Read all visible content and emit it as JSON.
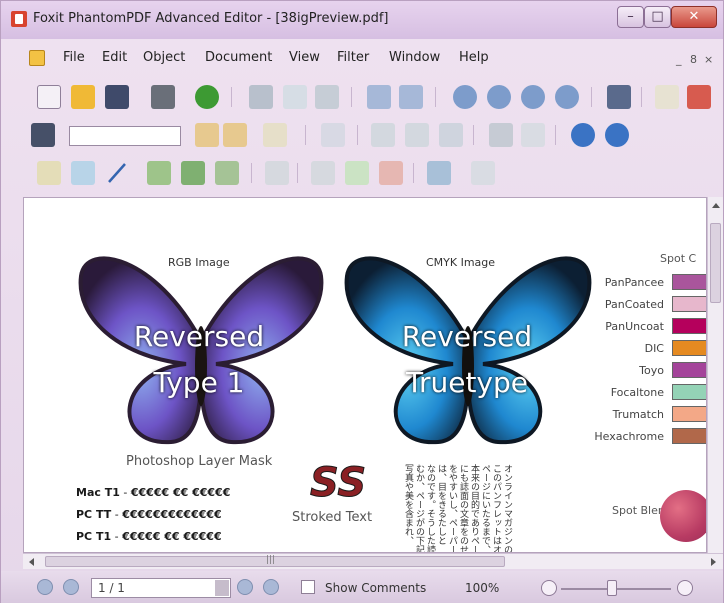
{
  "window": {
    "title": "Foxit PhantomPDF Advanced Editor - [38igPreview.pdf]",
    "controls": [
      "–",
      "□",
      "✕"
    ]
  },
  "menubar": {
    "items": [
      "File",
      "Edit",
      "Object",
      "Document",
      "View",
      "Filter",
      "Window",
      "Help"
    ],
    "mdi_controls": [
      "_",
      "8",
      "×"
    ]
  },
  "toolbar": {
    "search_value": ""
  },
  "document": {
    "rgb_label": "RGB Image",
    "cmyk_label": "CMYK Image",
    "left_butterfly_text": [
      "Reversed",
      "Type 1"
    ],
    "right_butterfly_text": [
      "Reversed",
      "Truetype"
    ],
    "photoshop_label": "Photoshop Layer Mask",
    "font_lines": [
      {
        "label": "Mac T1",
        "sample": "€€€€€ €€ €€€€€"
      },
      {
        "label": "PC TT",
        "sample": "€€€€€€€€€€€€€"
      },
      {
        "label": "PC T1",
        "sample": "€€€€€ €€ €€€€€"
      }
    ],
    "stroked_big": "SS",
    "stroked_label": "Stroked Text",
    "spot_header": "Spot C",
    "spot_colors": [
      {
        "name": "PanPancee",
        "color": "#a9559c"
      },
      {
        "name": "PanCoated",
        "color": "#e7b7cc"
      },
      {
        "name": "PanUncoat",
        "color": "#b5005c"
      },
      {
        "name": "DIC",
        "color": "#e58a21"
      },
      {
        "name": "Toyo",
        "color": "#a4449a"
      },
      {
        "name": "Focaltone",
        "color": "#94d3b6"
      },
      {
        "name": "Trumatch",
        "color": "#f3a887"
      },
      {
        "name": "Hexachrome",
        "color": "#b1684a"
      }
    ],
    "spot_blend_label": "Spot Blend",
    "japanese_columns": [
      "オンラインマガジンの",
      "このパンフレットはオ",
      "ページにいたるまで、",
      "本来の目的でありペー",
      "にも誌面の文章をのせ",
      "をやすいし、ペーパー",
      "は、目をきるたしと",
      "なのです。そうした読",
      "むか、ページがの下記",
      "写真や美を含まれ、"
    ]
  },
  "statusbar": {
    "page_value": "1 / 1",
    "show_comments": "Show Comments",
    "zoom": "100%"
  },
  "scroll_glyph": "|||"
}
